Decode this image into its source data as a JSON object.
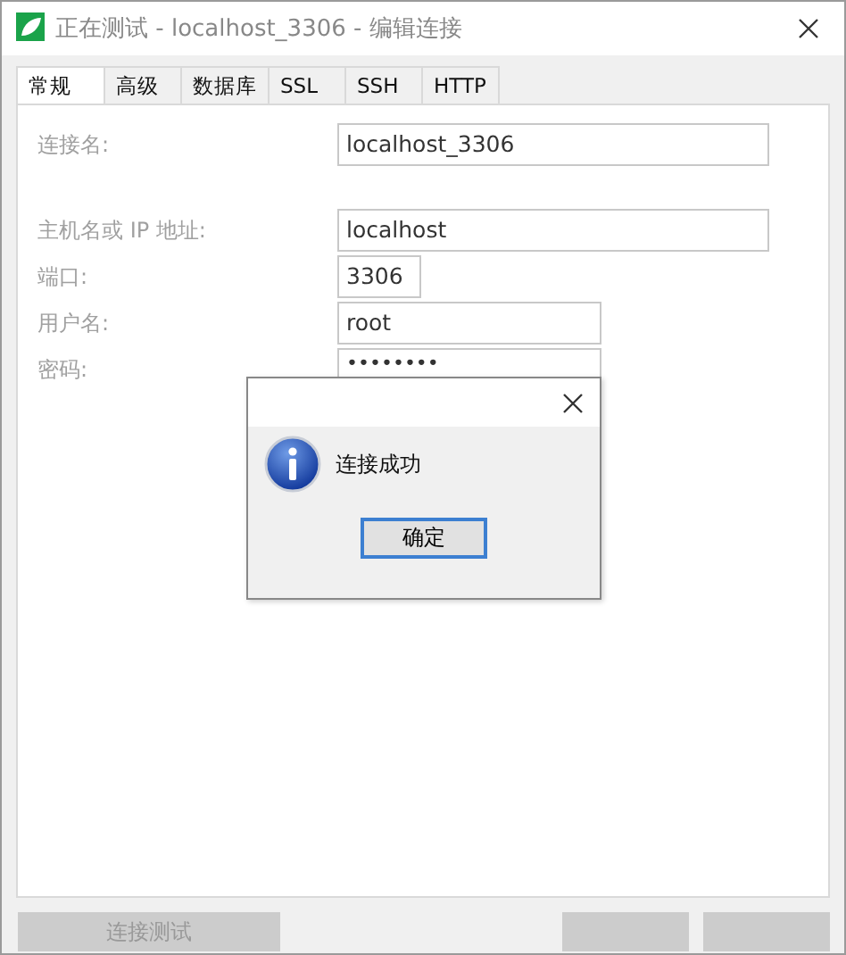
{
  "window": {
    "title": "正在测试 - localhost_3306 - 编辑连接"
  },
  "tabs": [
    {
      "label": "常规",
      "selected": true
    },
    {
      "label": "高级",
      "selected": false
    },
    {
      "label": "数据库",
      "selected": false
    },
    {
      "label": "SSL",
      "selected": false
    },
    {
      "label": "SSH",
      "selected": false
    },
    {
      "label": "HTTP",
      "selected": false
    }
  ],
  "form": [
    {
      "label": "连接名:",
      "value": "localhost_3306"
    },
    {
      "label": "主机名或 IP 地址:",
      "value": "localhost"
    },
    {
      "label": "端口:",
      "value": "3306"
    },
    {
      "label": "用户名:",
      "value": "root"
    },
    {
      "label": "密码:",
      "value": "••••••••"
    }
  ],
  "buttons": [
    {
      "label": "连接测试",
      "disabled": true
    }
  ],
  "message_box": {
    "message": "连接成功",
    "button": "确定"
  }
}
